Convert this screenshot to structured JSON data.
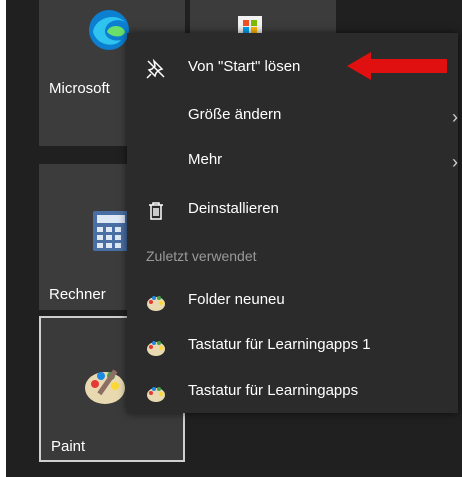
{
  "tiles": {
    "edge": {
      "label": "Microsoft"
    },
    "calc": {
      "label": "Rechner"
    },
    "paint": {
      "label": "Paint"
    }
  },
  "context_menu": {
    "unpin": "Von \"Start\" lösen",
    "resize": "Größe ändern",
    "more": "Mehr",
    "uninstall": "Deinstallieren",
    "recent_header": "Zuletzt verwendet",
    "recent_items": [
      "Folder neuneu",
      "Tastatur für Learningapps 1",
      "Tastatur für Learningapps"
    ],
    "submenu_chevron": "›"
  },
  "colors": {
    "start_background": "#202020",
    "tile": "#3c3c3c",
    "menu": "#2b2b2b",
    "annotation_arrow": "#e01010"
  },
  "icons": [
    "edge-icon",
    "store-icon",
    "calculator-icon",
    "paint-icon",
    "unpin-icon",
    "trash-icon",
    "paint-small-icon"
  ]
}
